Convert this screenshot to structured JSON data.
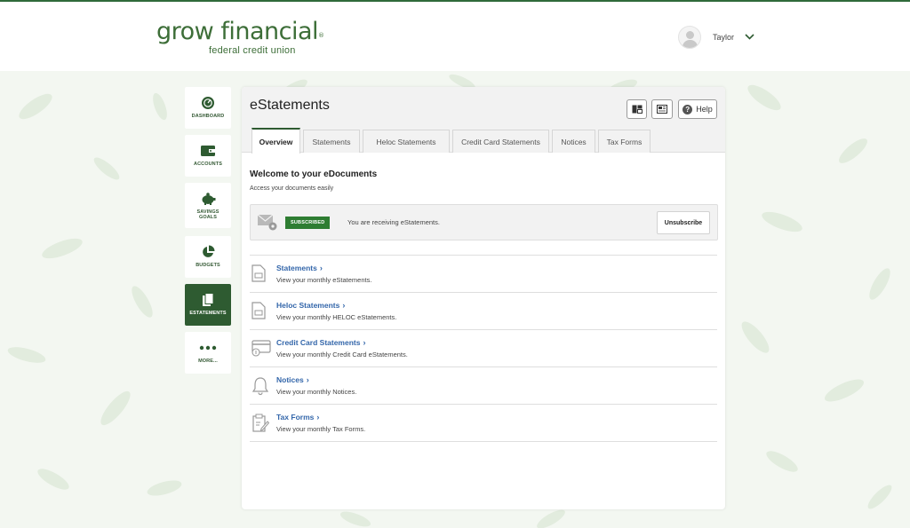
{
  "brand": {
    "name": "grow financial",
    "mark": "®",
    "tagline": "federal credit union"
  },
  "user": {
    "name": "Taylor"
  },
  "sidebar": {
    "items": [
      {
        "label": "DASHBOARD",
        "icon": "speedometer-icon"
      },
      {
        "label": "ACCOUNTS",
        "icon": "wallet-icon"
      },
      {
        "label": "SAVINGS GOALS",
        "icon": "piggy-bank-icon"
      },
      {
        "label": "BUDGETS",
        "icon": "pie-chart-icon"
      },
      {
        "label": "ESTATEMENTS",
        "icon": "documents-icon",
        "active": true
      },
      {
        "label": "MORE...",
        "icon": "more-dots-icon"
      }
    ]
  },
  "page": {
    "title": "eStatements",
    "help_label": "Help",
    "tabs": [
      {
        "label": "Overview",
        "active": true
      },
      {
        "label": "Statements"
      },
      {
        "label": "Heloc Statements"
      },
      {
        "label": "Credit Card Statements"
      },
      {
        "label": "Notices"
      },
      {
        "label": "Tax Forms"
      }
    ]
  },
  "overview": {
    "title": "Welcome to your eDocuments",
    "subtitle": "Access your documents easily",
    "subscription": {
      "badge": "SUBSCRIBED",
      "message": "You are receiving eStatements.",
      "button": "Unsubscribe"
    },
    "documents": [
      {
        "title": "Statements",
        "desc": "View your monthly eStatements.",
        "icon": "document-icon"
      },
      {
        "title": "Heloc Statements",
        "desc": "View your monthly HELOC eStatements.",
        "icon": "document-icon"
      },
      {
        "title": "Credit Card Statements",
        "desc": "View your monthly Credit Card eStatements.",
        "icon": "credit-card-icon"
      },
      {
        "title": "Notices",
        "desc": "View your monthly Notices.",
        "icon": "bell-icon"
      },
      {
        "title": "Tax Forms",
        "desc": "View your monthly Tax Forms.",
        "icon": "clipboard-edit-icon"
      }
    ]
  },
  "colors": {
    "brand_green": "#3d6e38",
    "nav_active": "#2e5b31",
    "badge_green": "#2e7d32",
    "link_blue": "#3366aa",
    "page_bg": "#f3f7f1"
  }
}
